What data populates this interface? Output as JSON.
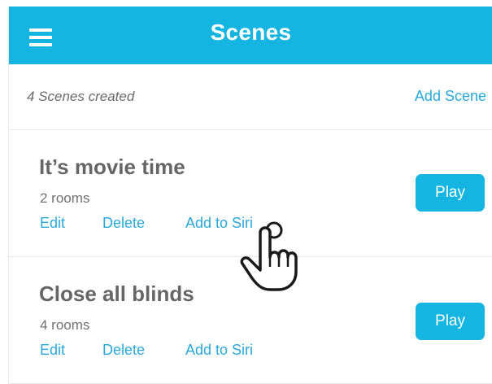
{
  "header": {
    "title": "Scenes",
    "menu_icon": "hamburger-menu-icon",
    "color": "#14b5e0"
  },
  "toolbar": {
    "count_text": "4 Scenes created",
    "add_label": "Add Scene"
  },
  "scenes": [
    {
      "name": "It’s movie time",
      "rooms": "2 rooms",
      "edit": "Edit",
      "delete": "Delete",
      "siri": "Add to Siri",
      "play": "Play"
    },
    {
      "name": "Close all blinds",
      "rooms": "4 rooms",
      "edit": "Edit",
      "delete": "Delete",
      "siri": "Add to Siri",
      "play": "Play"
    }
  ],
  "cursor": {
    "icon": "hand-pointer-icon"
  },
  "colors": {
    "accent": "#14b5e0",
    "link": "#2aa8d8",
    "text": "#666666"
  }
}
